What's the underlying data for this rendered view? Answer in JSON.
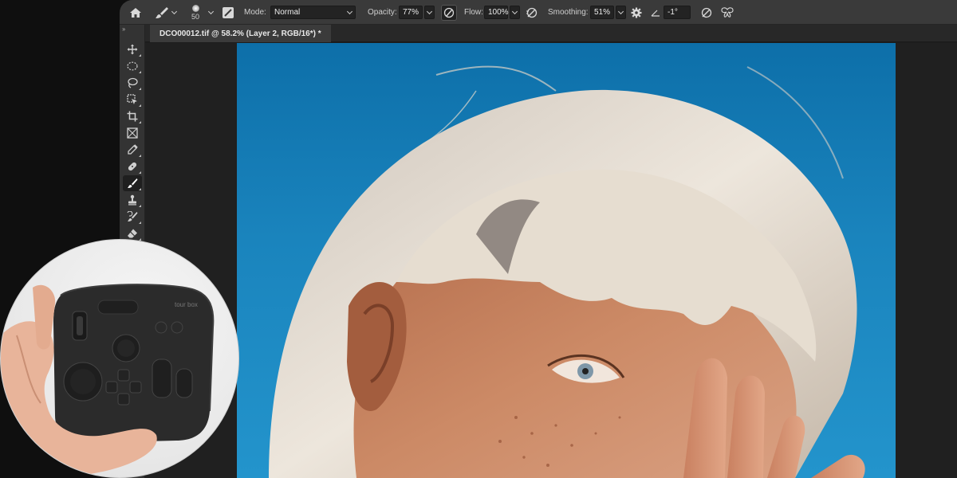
{
  "options_bar": {
    "brush_size": "50",
    "mode_label": "Mode:",
    "mode_value": "Normal",
    "opacity_label": "Opacity:",
    "opacity_value": "77%",
    "flow_label": "Flow:",
    "flow_value": "100%",
    "smoothing_label": "Smoothing:",
    "smoothing_value": "51%",
    "angle_value": "-1°"
  },
  "document": {
    "tab_title": "DCO00012.tif @ 58.2% (Layer 2, RGB/16*) *"
  },
  "toolbar": {
    "collapse_glyph": "››",
    "tools": [
      {
        "name": "move-tool",
        "icon": "move-icon"
      },
      {
        "name": "marquee-tool",
        "icon": "ellipse-marquee-icon"
      },
      {
        "name": "lasso-tool",
        "icon": "lasso-icon"
      },
      {
        "name": "object-select-tool",
        "icon": "object-select-icon"
      },
      {
        "name": "crop-tool",
        "icon": "crop-icon"
      },
      {
        "name": "frame-tool",
        "icon": "frame-icon"
      },
      {
        "name": "eyedropper-tool",
        "icon": "eyedropper-icon"
      },
      {
        "name": "healing-brush-tool",
        "icon": "healing-brush-icon"
      },
      {
        "name": "brush-tool",
        "icon": "brush-icon",
        "active": true
      },
      {
        "name": "clone-stamp-tool",
        "icon": "stamp-icon"
      },
      {
        "name": "history-brush-tool",
        "icon": "history-brush-icon"
      },
      {
        "name": "eraser-tool",
        "icon": "eraser-icon"
      }
    ]
  },
  "device": {
    "logo_text": "tour box"
  },
  "colors": {
    "sky": "#1a84bd",
    "ui_dark": "#1d1d1d",
    "options_bar": "#3a3a3a",
    "toolbar": "#333333"
  }
}
